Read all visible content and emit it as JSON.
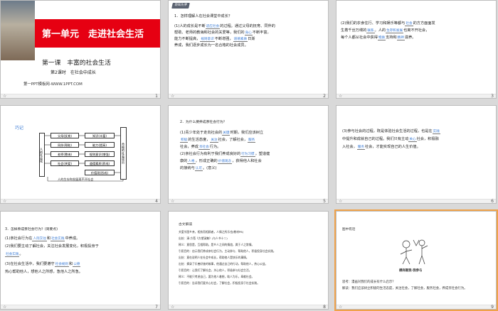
{
  "slide_numbers": [
    "1",
    "2",
    "3",
    "4",
    "5",
    "6",
    "7",
    "8",
    "9"
  ],
  "s1": {
    "unit": "第一单元　走进社会生活",
    "lesson": "第一课　丰富的社会生活",
    "period": "第2课时　在社会中成长",
    "footer": "第一PPT模板网-WWW.1PPT.COM"
  },
  "s2": {
    "badge": "新知先学",
    "q": "1．怎样理解人在社会课堂中成长？",
    "p1a": "(1)人的成长是不断",
    "f1": "适应社会",
    "p1b": "的过程。通过父母的抚育、同伴的",
    "p2": "帮助、老师的教诲和社会的关爱等，我们的",
    "f2": "身心",
    "p2b": "不断丰富，",
    "p3a": "能力不断提高，",
    "f3": "规则意识",
    "p3b": "不断增强，",
    "f4": "道德素质",
    "p3c": "日渐",
    "p4": "养成，我们逐步成长为一名合格的社会成员。"
  },
  "s3": {
    "p1a": "(2)我们的衣食住行、学习和娱乐等都与",
    "f1": "社会",
    "p1b": "的方方面面发",
    "p2a": "生着千丝万缕的",
    "f2": "联系",
    "p2b": "。人的",
    "f3": "生存和发展",
    "p2c": "也离不开社会，",
    "p3a": "每个人都从社会中获得",
    "f4": "物质",
    "p3b": "支持和",
    "f5": "精神",
    "p3c": "滋养。"
  },
  "s4": {
    "title": "巧记",
    "left": "人的社会化",
    "right": "合格的社会成员",
    "rows": [
      [
        "父母(抚育)",
        "知识(丰富)"
      ],
      [
        "同伴(帮助)",
        "能力(提高)"
      ],
      [
        "老师(教诲)",
        "规则意识(增强)"
      ],
      [
        "社会(关爱)",
        "道德素质(养成)"
      ],
      [
        "",
        "价值观(形成)"
      ]
    ],
    "bottom": "人的生存和发展离不开社会"
  },
  "s5": {
    "q": "2．为什么要养成亲社会行为？",
    "p1a": "(1)青少年处于走向社会的",
    "f1": "关键",
    "p1b": "时期，我们应该树立",
    "p2a": "",
    "f2": "积极",
    "p2b": "的生活态度，",
    "f3": "关注",
    "p2c": "社会，了解社会，",
    "f4": "服务",
    "p3": "社会，养成",
    "f5": "亲社会",
    "p3b": "行为。",
    "p4a": "(2)亲社会行为有利于我们养成良好的",
    "f6": "行为习惯",
    "p4b": "，塑造健",
    "p5a": "康的",
    "f7": "人格",
    "p5b": "，形成正确的",
    "f8": "价值观念",
    "p5c": "，获得他人和社会",
    "p6a": "的接纳与",
    "f9": "认可",
    "p6b": "。(意义)"
  },
  "s6": {
    "p1a": "(3)参与社会的过程，既是体验社会生活的过程，也是在",
    "f1": "实践",
    "p2": "中提升和成就自己的过程。我们只有主动",
    "f2": "关心",
    "p2b": "社会，积极融",
    "p3a": "入社会，",
    "f3": "服务",
    "p3b": "社会，才能实现自己的人生价值。"
  },
  "s7": {
    "q": "3．怎样养成亲社会行为？(简要点)",
    "p1a": "(1)亲社会行为在",
    "f1": "人际交往",
    "p1b": "和",
    "f2": "社会实践",
    "p1c": "中养成。",
    "p2": "(2)我们要主动了解社会，关注社会发展变化，积极投身于",
    "f3": "社会实践",
    "p2b": "。",
    "p4a": "(3)在社会生活中，我们要遵守",
    "f4": "社会规则",
    "p4b": "和",
    "f5": "公德",
    "p5": "热心帮助他人，想他人之所想，急他人之所急。"
  },
  "s8": {
    "title": "古文解读",
    "lines": [
      "关爱邻里乡亲，相扶而相顾者，人情之所乐也(教材P8)",
      "出处：清·方苞《方望溪集》(与人书十二)",
      "释义：意思是，互相帮助，是乡人之间的情谊，属于人之常情。",
      "引用目的：启示我们养成亲社会行为，主动参与、帮助他人，积极投身社会实践。",
      "出处：意在说明人在社会中成长，帮助他人是快乐的事情。",
      "出处：摘录了乐善好施的故事，他通过自己的行动，帮助他人，热心公益。",
      "引用目的：让我们了解社会，关心他人，积极参与社会生活。",
      "释义：不能只考虑自己，要为他人着想，助人为乐，奉献社会。",
      "引用目的：告诉我们要关心社会，了解社会，积极投身于社会实践。"
    ]
  },
  "s9": {
    "title": "图中有话",
    "caption": "模样跟我·我参与",
    "q": "思考：漫画对我们的成长有什么启示？",
    "a": "解读：我们应该树立积极的生活态度，关注社会，了解社会，服务社会，养成亲社会行为。"
  }
}
